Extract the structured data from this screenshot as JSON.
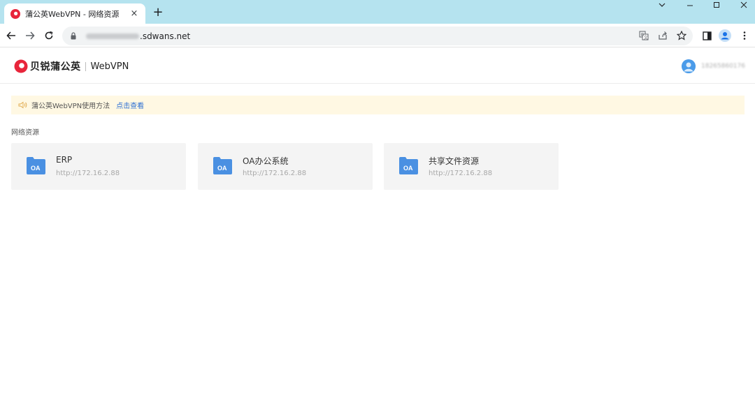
{
  "browser": {
    "tab_title": "蒲公英WebVPN - 网络资源",
    "tab_close": "×",
    "new_tab": "+",
    "url_domain": ".sdwans.net"
  },
  "header": {
    "brand": "贝锐蒲公英",
    "product": "WebVPN",
    "username": "18265860176"
  },
  "notice": {
    "text": "蒲公英WebVPN使用方法",
    "link": "点击查看"
  },
  "section": {
    "title": "网络资源"
  },
  "resources": [
    {
      "icon_label": "OA",
      "name": "ERP",
      "url": "http://172.16.2.88"
    },
    {
      "icon_label": "OA",
      "name": "OA办公系统",
      "url": "http://172.16.2.88"
    },
    {
      "icon_label": "OA",
      "name": "共享文件资源",
      "url": "http://172.16.2.88"
    }
  ],
  "colors": {
    "titlebar": "#b5e3ef",
    "brand_red": "#e8253b",
    "link_blue": "#2d6fd3",
    "folder_blue": "#4a90e2",
    "notice_bg": "#fff8e3"
  }
}
